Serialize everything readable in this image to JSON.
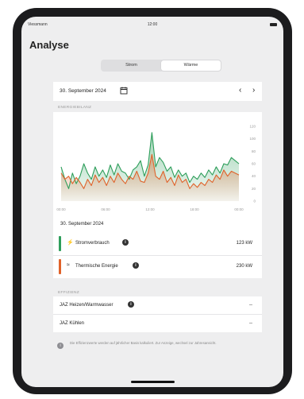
{
  "status_bar": {
    "carrier": "Viessmann",
    "time": "12:00"
  },
  "page_title": "Analyse",
  "segments": [
    {
      "label": "Strom",
      "active": false
    },
    {
      "label": "Wärme",
      "active": true
    }
  ],
  "date_picker": {
    "date": "30. September 2024",
    "calendar_icon": "calendar-icon",
    "prev_icon": "chevron-left-icon",
    "next_icon": "chevron-right-icon",
    "prev_label": "‹",
    "next_label": "›"
  },
  "energy_section": {
    "label": "ENERGIEBILANZ"
  },
  "chart_data": {
    "type": "area",
    "x": [
      "00:00",
      "00:30",
      "01:00",
      "01:30",
      "02:00",
      "02:30",
      "03:00",
      "03:30",
      "04:00",
      "04:30",
      "05:00",
      "05:30",
      "06:00",
      "06:30",
      "07:00",
      "07:30",
      "08:00",
      "08:30",
      "09:00",
      "09:30",
      "10:00",
      "10:30",
      "11:00",
      "11:30",
      "12:00",
      "12:30",
      "13:00",
      "13:30",
      "14:00",
      "14:30",
      "15:00",
      "15:30",
      "16:00",
      "16:30",
      "17:00",
      "17:30",
      "18:00",
      "18:30",
      "19:00",
      "19:30",
      "20:00",
      "20:30",
      "21:00",
      "21:30",
      "22:00",
      "22:30",
      "23:00",
      "23:30"
    ],
    "x_ticks": [
      "00:00",
      "06:00",
      "12:00",
      "18:00",
      "00:00"
    ],
    "y_ticks": [
      0,
      20,
      40,
      60,
      80,
      100,
      120
    ],
    "ylim": [
      0,
      120
    ],
    "series": [
      {
        "color": "#2e9e5b",
        "values": [
          55,
          35,
          20,
          45,
          28,
          40,
          60,
          45,
          35,
          55,
          40,
          50,
          38,
          58,
          42,
          60,
          48,
          45,
          35,
          50,
          55,
          65,
          40,
          58,
          110,
          55,
          70,
          62,
          48,
          55,
          38,
          50,
          40,
          45,
          30,
          40,
          35,
          45,
          38,
          50,
          42,
          55,
          45,
          60,
          58,
          70,
          65,
          60
        ]
      },
      {
        "color": "#e0622a",
        "values": [
          45,
          35,
          40,
          28,
          38,
          30,
          20,
          35,
          25,
          42,
          30,
          38,
          25,
          40,
          30,
          45,
          35,
          28,
          40,
          35,
          48,
          32,
          30,
          45,
          75,
          40,
          35,
          48,
          30,
          38,
          25,
          42,
          30,
          35,
          20,
          28,
          22,
          30,
          25,
          35,
          30,
          42,
          35,
          50,
          40,
          48,
          45,
          42
        ]
      }
    ]
  },
  "chart_date": "30. September 2024",
  "rows": [
    {
      "icon": "⚡",
      "icon_name": "lightning-icon",
      "label": "Stromverbrauch",
      "value": "123 kW",
      "color": "#2e9e5b"
    },
    {
      "icon": "≈",
      "icon_name": "heat-waves-icon",
      "label": "Thermische Energie",
      "value": "230 kW",
      "color": "#e0622a"
    }
  ],
  "efficiency_section": {
    "label": "EFFIZIENZ"
  },
  "efficiency_rows": [
    {
      "label": "JAZ Heizen/Warmwasser",
      "value": "--"
    },
    {
      "label": "JAZ Kühlen",
      "value": "--"
    }
  ],
  "info_glyph": "i",
  "note": "Die Effizienzwerte werden auf jährlicher Basis kalkuliert. Zur Anzeige, wechsel zur Jahresansicht."
}
